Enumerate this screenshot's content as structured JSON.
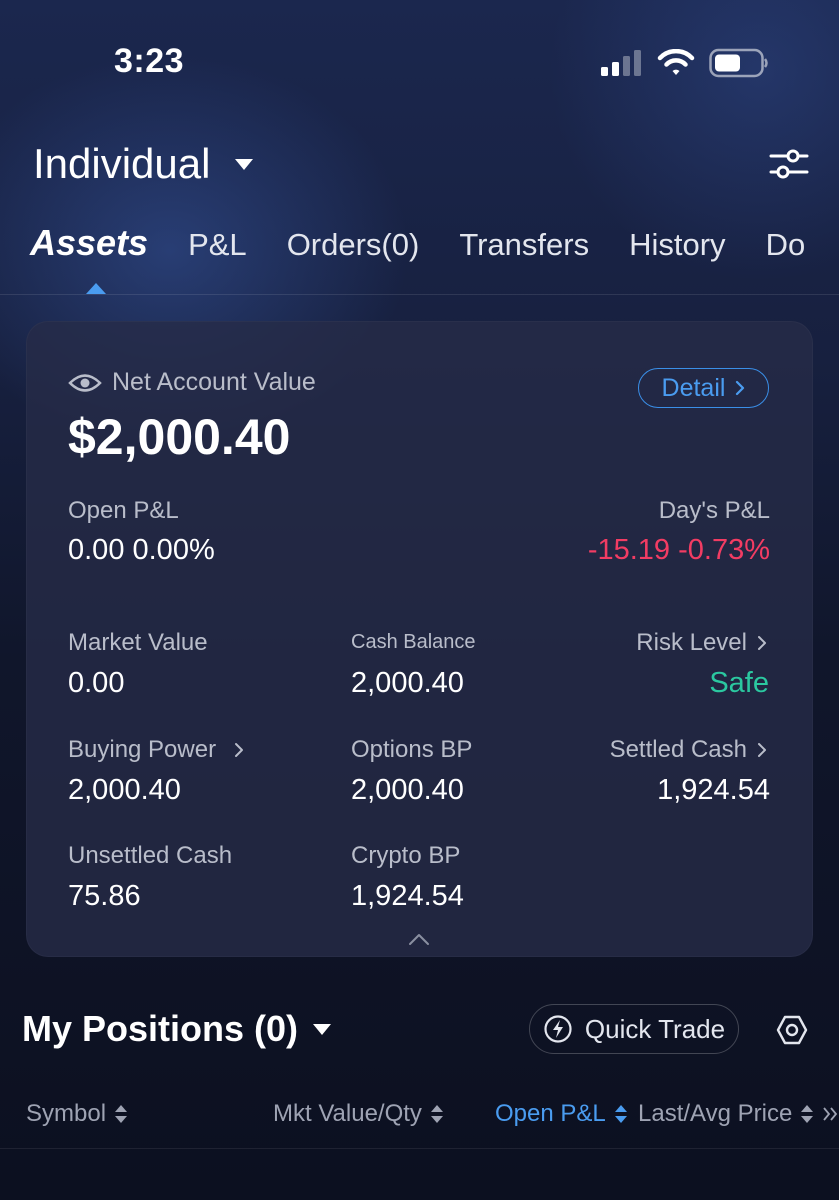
{
  "status_bar": {
    "time": "3:23"
  },
  "header": {
    "account_name": "Individual"
  },
  "tabs": [
    {
      "label": "Assets",
      "active": true
    },
    {
      "label": "P&L"
    },
    {
      "label": "Orders(0)"
    },
    {
      "label": "Transfers"
    },
    {
      "label": "History"
    },
    {
      "label": "Do"
    }
  ],
  "summary": {
    "net_label": "Net Account Value",
    "net_value": "$2,000.40",
    "detail_label": "Detail",
    "open_pl_label": "Open P&L",
    "open_pl_value": "0.00 0.00%",
    "days_pl_label": "Day's P&L",
    "days_pl_value": "-15.19 -0.73%",
    "market_value_label": "Market Value",
    "market_value": "0.00",
    "cash_balance_label": "Cash Balance",
    "cash_balance": "2,000.40",
    "risk_label": "Risk Level",
    "risk_value": "Safe",
    "buying_power_label": "Buying Power",
    "buying_power": "2,000.40",
    "options_bp_label": "Options BP",
    "options_bp": "2,000.40",
    "settled_cash_label": "Settled Cash",
    "settled_cash": "1,924.54",
    "unsettled_cash_label": "Unsettled Cash",
    "unsettled_cash": "75.86",
    "crypto_bp_label": "Crypto BP",
    "crypto_bp": "1,924.54"
  },
  "positions": {
    "title": "My Positions (0)",
    "quick_trade_label": "Quick Trade",
    "columns": [
      "Symbol",
      "Mkt Value/Qty",
      "Open P&L",
      "Last/Avg Price"
    ]
  },
  "colors": {
    "accent": "#4a9cf0",
    "negative": "#f23c63",
    "positive": "#2bc8a0",
    "background": "#0d1222",
    "card": "#262c48"
  }
}
